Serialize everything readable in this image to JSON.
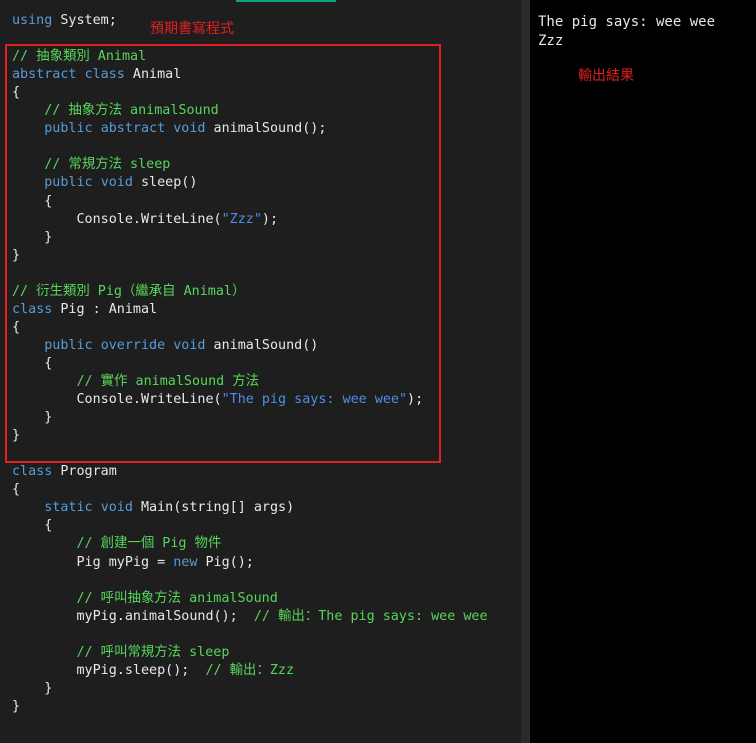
{
  "colors": {
    "keyword": "#569cd6",
    "comment": "#57d65a",
    "string": "#4f8ee6",
    "plain": "#e8e8e8",
    "annotation": "#e02020",
    "editor_bg": "#1e1e1e",
    "output_bg": "#000000"
  },
  "annotations": {
    "expected_code": "預期書寫程式",
    "output_result": "輸出結果"
  },
  "output": {
    "lines": [
      "The pig says: wee wee",
      "Zzz"
    ]
  },
  "code": [
    [
      [
        "kw",
        "using"
      ],
      [
        "pl",
        " System;"
      ]
    ],
    [],
    [
      [
        "cm",
        "// 抽象類別 Animal"
      ]
    ],
    [
      [
        "kw",
        "abstract"
      ],
      [
        "pl",
        " "
      ],
      [
        "kw",
        "class"
      ],
      [
        "pl",
        " Animal"
      ]
    ],
    [
      [
        "pl",
        "{"
      ]
    ],
    [
      [
        "pl",
        "    "
      ],
      [
        "cm",
        "// 抽象方法 animalSound"
      ]
    ],
    [
      [
        "pl",
        "    "
      ],
      [
        "kw",
        "public"
      ],
      [
        "pl",
        " "
      ],
      [
        "kw",
        "abstract"
      ],
      [
        "pl",
        " "
      ],
      [
        "kw",
        "void"
      ],
      [
        "pl",
        " animalSound();"
      ]
    ],
    [],
    [
      [
        "pl",
        "    "
      ],
      [
        "cm",
        "// 常規方法 sleep"
      ]
    ],
    [
      [
        "pl",
        "    "
      ],
      [
        "kw",
        "public"
      ],
      [
        "pl",
        " "
      ],
      [
        "kw",
        "void"
      ],
      [
        "pl",
        " sleep()"
      ]
    ],
    [
      [
        "pl",
        "    {"
      ]
    ],
    [
      [
        "pl",
        "        Console.WriteLine("
      ],
      [
        "str",
        "\"Zzz\""
      ],
      [
        "pl",
        ");"
      ]
    ],
    [
      [
        "pl",
        "    }"
      ]
    ],
    [
      [
        "pl",
        "}"
      ]
    ],
    [],
    [
      [
        "cm",
        "// 衍生類別 Pig（繼承自 Animal）"
      ]
    ],
    [
      [
        "kw",
        "class"
      ],
      [
        "pl",
        " Pig : Animal"
      ]
    ],
    [
      [
        "pl",
        "{"
      ]
    ],
    [
      [
        "pl",
        "    "
      ],
      [
        "kw",
        "public"
      ],
      [
        "pl",
        " "
      ],
      [
        "kw",
        "override"
      ],
      [
        "pl",
        " "
      ],
      [
        "kw",
        "void"
      ],
      [
        "pl",
        " animalSound()"
      ]
    ],
    [
      [
        "pl",
        "    {"
      ]
    ],
    [
      [
        "pl",
        "        "
      ],
      [
        "cm",
        "// 實作 animalSound 方法"
      ]
    ],
    [
      [
        "pl",
        "        Console.WriteLine("
      ],
      [
        "str",
        "\"The pig says: wee wee\""
      ],
      [
        "pl",
        ");"
      ]
    ],
    [
      [
        "pl",
        "    }"
      ]
    ],
    [
      [
        "pl",
        "}"
      ]
    ],
    [],
    [
      [
        "kw",
        "class"
      ],
      [
        "pl",
        " Program"
      ]
    ],
    [
      [
        "pl",
        "{"
      ]
    ],
    [
      [
        "pl",
        "    "
      ],
      [
        "kw",
        "static"
      ],
      [
        "pl",
        " "
      ],
      [
        "kw",
        "void"
      ],
      [
        "pl",
        " Main(string[] args)"
      ]
    ],
    [
      [
        "pl",
        "    {"
      ]
    ],
    [
      [
        "pl",
        "        "
      ],
      [
        "cm",
        "// 創建一個 Pig 物件"
      ]
    ],
    [
      [
        "pl",
        "        Pig myPig = "
      ],
      [
        "kw",
        "new"
      ],
      [
        "pl",
        " Pig();"
      ]
    ],
    [],
    [
      [
        "pl",
        "        "
      ],
      [
        "cm",
        "// 呼叫抽象方法 animalSound"
      ]
    ],
    [
      [
        "pl",
        "        myPig.animalSound();  "
      ],
      [
        "cm",
        "// 輸出：The pig says: wee wee"
      ]
    ],
    [],
    [
      [
        "pl",
        "        "
      ],
      [
        "cm",
        "// 呼叫常規方法 sleep"
      ]
    ],
    [
      [
        "pl",
        "        myPig.sleep();  "
      ],
      [
        "cm",
        "// 輸出：Zzz"
      ]
    ],
    [
      [
        "pl",
        "    }"
      ]
    ],
    [
      [
        "pl",
        "}"
      ]
    ]
  ]
}
